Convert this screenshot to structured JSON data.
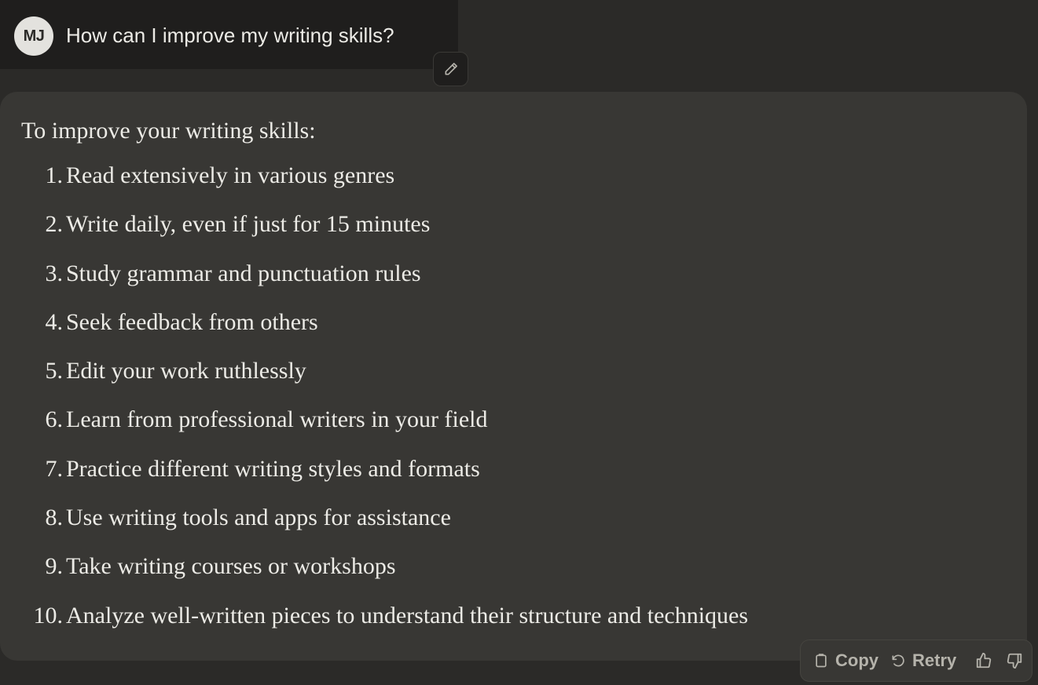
{
  "user": {
    "initials": "MJ",
    "message": "How can I improve my writing skills?"
  },
  "assistant": {
    "intro": "To improve your writing skills:",
    "items": [
      {
        "num": "1.",
        "text": "Read extensively in various genres"
      },
      {
        "num": "2.",
        "text": "Write daily, even if just for 15 minutes"
      },
      {
        "num": "3.",
        "text": "Study grammar and punctuation rules"
      },
      {
        "num": "4.",
        "text": "Seek feedback from others"
      },
      {
        "num": "5.",
        "text": "Edit your work ruthlessly"
      },
      {
        "num": "6.",
        "text": "Learn from professional writers in your field"
      },
      {
        "num": "7.",
        "text": "Practice different writing styles and formats"
      },
      {
        "num": "8.",
        "text": "Use writing tools and apps for assistance"
      },
      {
        "num": "9.",
        "text": "Take writing courses or workshops"
      },
      {
        "num": "10.",
        "text": "Analyze well-written pieces to understand their structure and techniques"
      }
    ]
  },
  "actions": {
    "copy_label": "Copy",
    "retry_label": "Retry",
    "copy_icon": "clipboard-icon",
    "retry_icon": "retry-icon",
    "thumbs_up_icon": "thumbs-up-icon",
    "thumbs_down_icon": "thumbs-down-icon"
  },
  "colors": {
    "background": "#2b2a28",
    "user_bubble": "#1f1e1d",
    "assistant_bubble": "#383734",
    "text": "#ecebe6",
    "muted": "#b5b3ab"
  }
}
